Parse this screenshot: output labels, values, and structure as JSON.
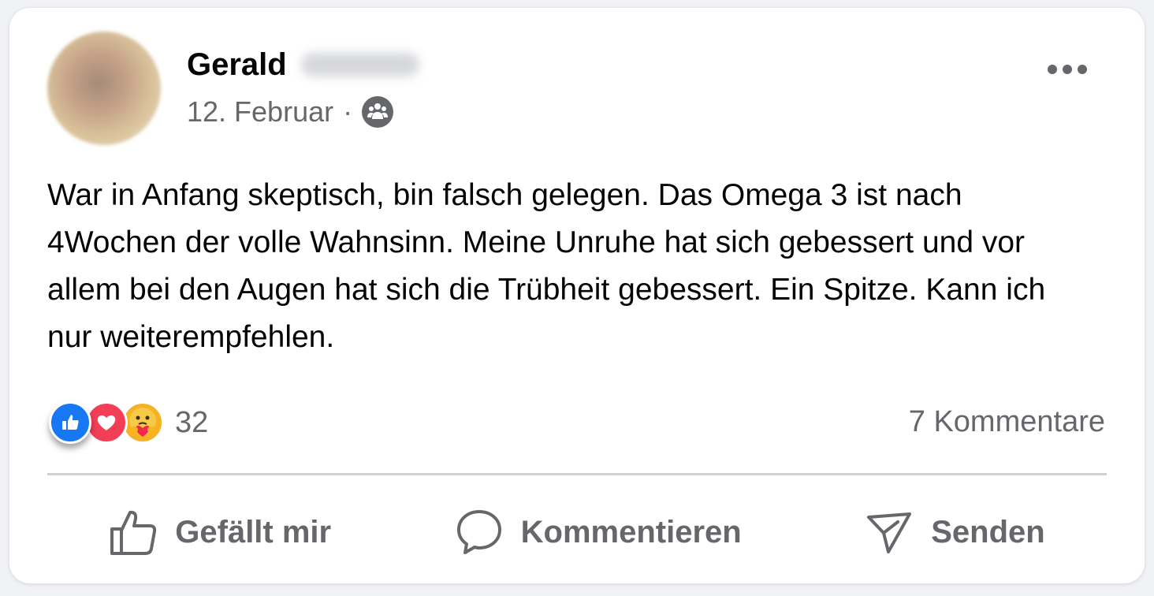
{
  "post": {
    "author_first_name": "Gerald",
    "date": "12. Februar",
    "separator": "·",
    "audience_icon": "friends-group-icon",
    "text": "War in Anfang skeptisch, bin falsch gelegen. Das Omega 3 ist nach 4Wochen der volle Wahnsinn. Meine Unruhe hat sich gebessert und vor allem bei den Augen hat sich die Trübheit gebessert. Ein Spitze. Kann ich nur weiterempfehlen."
  },
  "reactions": {
    "icons": [
      "like-icon",
      "love-icon",
      "care-icon"
    ],
    "count": "32"
  },
  "comments": {
    "count_label": "7 Kommentare"
  },
  "actions": {
    "like_label": "Gefällt mir",
    "comment_label": "Kommentieren",
    "send_label": "Senden"
  },
  "colors": {
    "like_blue": "#1877f2",
    "love_red": "#f33e58",
    "care_yellow": "#f7b125",
    "secondary_text": "#65676b"
  }
}
